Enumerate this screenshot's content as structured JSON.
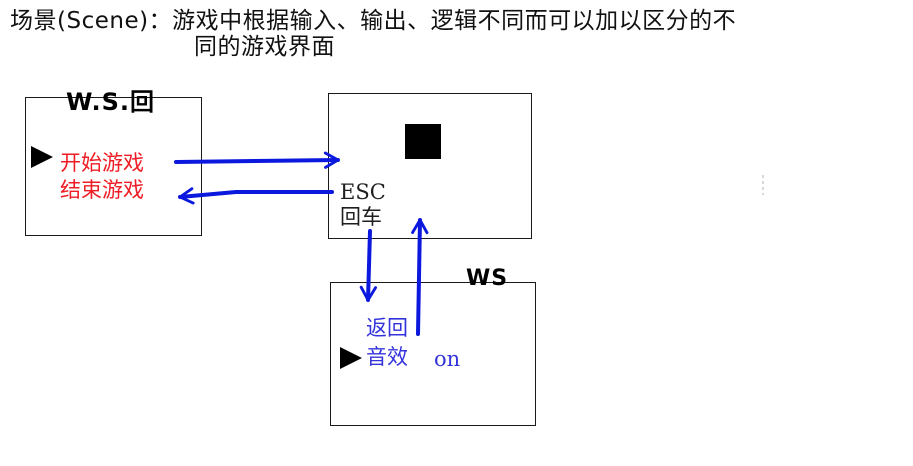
{
  "definition": {
    "line1": "场景(Scene)：游戏中根据输入、输出、逻辑不同而可以加以区分的不",
    "line2": "同的游戏界面"
  },
  "screens": {
    "menu": {
      "handwritten_label": "W.S.回",
      "options": [
        "开始游戏",
        "结束游戏"
      ]
    },
    "game": {
      "keys": [
        "ESC",
        "回车"
      ]
    },
    "settings": {
      "handwritten_label": "WS",
      "options": [
        "返回",
        "音效"
      ],
      "sound_value": "on"
    }
  },
  "colors": {
    "menu_text": "#ee1c24",
    "settings_text": "#3333dd",
    "arrow": "#0b18dd",
    "ink": "#000000"
  },
  "icons": {
    "cursor": "black-triangle-pointer-icon",
    "player": "black-square-icon",
    "transition": "blue-arrow-icon"
  }
}
